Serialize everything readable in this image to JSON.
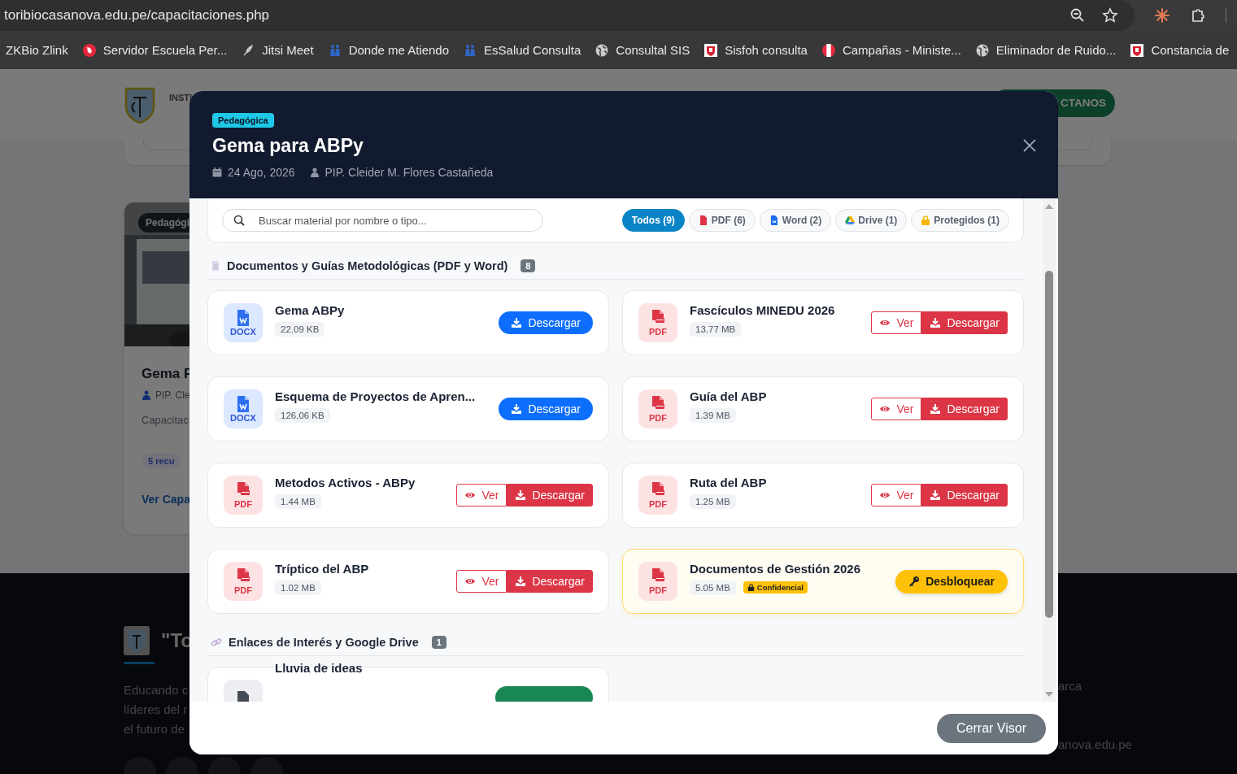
{
  "browser": {
    "url": "toribiocasanova.edu.pe/capacitaciones.php",
    "bookmarks": [
      {
        "label": "ZKBio Zlink",
        "kind": "none"
      },
      {
        "label": "Servidor Escuela Per...",
        "kind": "red-circle"
      },
      {
        "label": "Jitsi Meet",
        "kind": "quill"
      },
      {
        "label": "Donde me Atiendo",
        "kind": "people"
      },
      {
        "label": "EsSalud Consulta",
        "kind": "people"
      },
      {
        "label": "Consultal SIS",
        "kind": "globe"
      },
      {
        "label": "Sisfoh consulta",
        "kind": "crest"
      },
      {
        "label": "Campañas - Ministe...",
        "kind": "flag"
      },
      {
        "label": "Eliminador de Ruido...",
        "kind": "globe"
      },
      {
        "label": "Constancia de",
        "kind": "crest"
      }
    ]
  },
  "background_page": {
    "header": {
      "brand": "INSTI",
      "button": "CTANOS"
    },
    "card": {
      "badge": "Pedagógi",
      "title": "Gema F",
      "author": "PIP. Cle",
      "description": "Capacitac",
      "resources": "5 recu",
      "link": "Ver Capa"
    },
    "footer": {
      "title": "\"To",
      "lines": [
        "Educando c",
        "líderes del r",
        "el futuro de"
      ],
      "right_texts": [
        "arca",
        "anova.edu.pe"
      ]
    }
  },
  "modal": {
    "category": "Pedagógica",
    "title": "Gema para ABPy",
    "date": "24 Ago, 2026",
    "author": "PIP. Cleider M. Flores Castañeda",
    "search": {
      "placeholder": "Buscar material por nombre o tipo..."
    },
    "filters": [
      {
        "label": "Todos (9)",
        "kind": "all",
        "selected": true
      },
      {
        "label": "PDF (6)",
        "kind": "pdf",
        "selected": false
      },
      {
        "label": "Word (2)",
        "kind": "word",
        "selected": false
      },
      {
        "label": "Drive (1)",
        "kind": "drive",
        "selected": false
      },
      {
        "label": "Protegidos (1)",
        "kind": "locked",
        "selected": false
      }
    ],
    "sections": [
      {
        "title": "Documentos y Guías Metodológicas (PDF y Word)",
        "count": "8",
        "kind": "documents",
        "items": [
          {
            "name": "Gema ABPy",
            "kind": "docx",
            "type_label": "DOCX",
            "size": "22.09 KB",
            "locked": false,
            "actions": [
              {
                "kind": "download",
                "label": "Descargar"
              }
            ]
          },
          {
            "name": "Fascículos MINEDU 2026",
            "kind": "pdf",
            "type_label": "PDF",
            "size": "13.77 MB",
            "locked": false,
            "actions": [
              {
                "kind": "view",
                "label": "Ver"
              },
              {
                "kind": "pdf-download",
                "label": "Descargar"
              }
            ]
          },
          {
            "name": "Esquema de Proyectos de Apren...",
            "kind": "docx",
            "type_label": "DOCX",
            "size": "126.06 KB",
            "locked": false,
            "actions": [
              {
                "kind": "download",
                "label": "Descargar"
              }
            ]
          },
          {
            "name": "Guía del ABP",
            "kind": "pdf",
            "type_label": "PDF",
            "size": "1.39 MB",
            "locked": false,
            "actions": [
              {
                "kind": "view",
                "label": "Ver"
              },
              {
                "kind": "pdf-download",
                "label": "Descargar"
              }
            ]
          },
          {
            "name": "Metodos Activos - ABPy",
            "kind": "pdf",
            "type_label": "PDF",
            "size": "1.44 MB",
            "locked": false,
            "actions": [
              {
                "kind": "view",
                "label": "Ver"
              },
              {
                "kind": "pdf-download",
                "label": "Descargar"
              }
            ]
          },
          {
            "name": "Ruta del ABP",
            "kind": "pdf",
            "type_label": "PDF",
            "size": "1.25 MB",
            "locked": false,
            "actions": [
              {
                "kind": "view",
                "label": "Ver"
              },
              {
                "kind": "pdf-download",
                "label": "Descargar"
              }
            ]
          },
          {
            "name": "Tríptico del ABP",
            "kind": "pdf",
            "type_label": "PDF",
            "size": "1.02 MB",
            "locked": false,
            "actions": [
              {
                "kind": "view",
                "label": "Ver"
              },
              {
                "kind": "pdf-download",
                "label": "Descargar"
              }
            ]
          },
          {
            "name": "Documentos de Gestión 2026",
            "kind": "pdf",
            "type_label": "PDF",
            "size": "5.05 MB",
            "locked": true,
            "badge": "Confidencial",
            "actions": [
              {
                "kind": "unlock",
                "label": "Desbloquear"
              }
            ]
          }
        ]
      },
      {
        "title": "Enlaces de Interés y Google Drive",
        "count": "1",
        "kind": "links",
        "items": [
          {
            "name": "Lluvia de ideas",
            "kind": "link",
            "locked": false,
            "actions": [
              {
                "kind": "open"
              }
            ]
          }
        ]
      }
    ],
    "close_button": "Cerrar Visor"
  }
}
